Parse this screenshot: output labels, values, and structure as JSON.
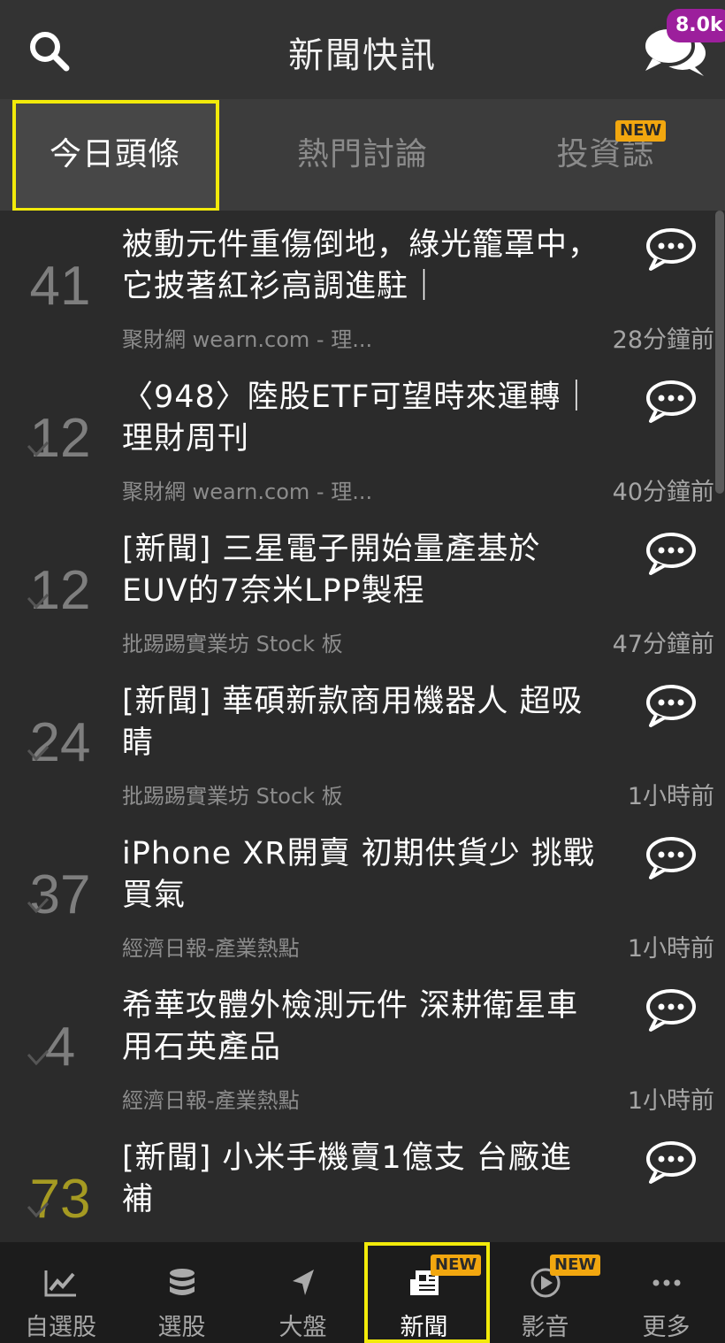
{
  "header": {
    "title": "新聞快訊",
    "chat_badge": "8.0k",
    "search_icon": "search-icon",
    "chat_icon": "chat-bubbles-icon"
  },
  "tabs": [
    {
      "label": "今日頭條",
      "active": true
    },
    {
      "label": "熱門討論",
      "active": false
    },
    {
      "label": "投資誌",
      "active": false,
      "tag": "NEW"
    }
  ],
  "news": [
    {
      "count": "41",
      "headline": "被動元件重傷倒地，綠光籠罩中，它披著紅衫高調進駐｜",
      "source": "聚財網 wearn.com - 理...",
      "time": "28分鐘前"
    },
    {
      "count": "12",
      "headline": "〈948〉陸股ETF可望時來運轉｜理財周刊",
      "source": "聚財網 wearn.com - 理...",
      "time": "40分鐘前"
    },
    {
      "count": "12",
      "headline": "[新聞] 三星電子開始量產基於EUV的7奈米LPP製程",
      "source": "批踢踢實業坊 Stock 板",
      "time": "47分鐘前"
    },
    {
      "count": "24",
      "headline": "[新聞] 華碩新款商用機器人 超吸睛",
      "source": "批踢踢實業坊 Stock 板",
      "time": "1小時前"
    },
    {
      "count": "37",
      "headline": "iPhone XR開賣 初期供貨少 挑戰買氣",
      "source": "經濟日報-產業熱點",
      "time": "1小時前"
    },
    {
      "count": "4",
      "headline": "希華攻體外檢測元件 深耕衛星車用石英產品",
      "source": "經濟日報-產業熱點",
      "time": "1小時前"
    },
    {
      "count": "73",
      "headline": "[新聞] 小米手機賣1億支 台廠進補",
      "source": "",
      "time": "",
      "hot": true
    }
  ],
  "nav": [
    {
      "label": "自選股",
      "icon": "line-chart-icon"
    },
    {
      "label": "選股",
      "icon": "database-icon"
    },
    {
      "label": "大盤",
      "icon": "navigation-arrow-icon"
    },
    {
      "label": "新聞",
      "icon": "newspaper-icon",
      "active": true,
      "tag": "NEW"
    },
    {
      "label": "影音",
      "icon": "play-circle-icon",
      "tag": "NEW"
    },
    {
      "label": "更多",
      "icon": "more-dots-icon"
    }
  ],
  "colors": {
    "highlight": "#f2ea0a",
    "new_tag": "#f2a70f",
    "badge": "#9c1f9c",
    "hot_count": "#a59a22"
  }
}
